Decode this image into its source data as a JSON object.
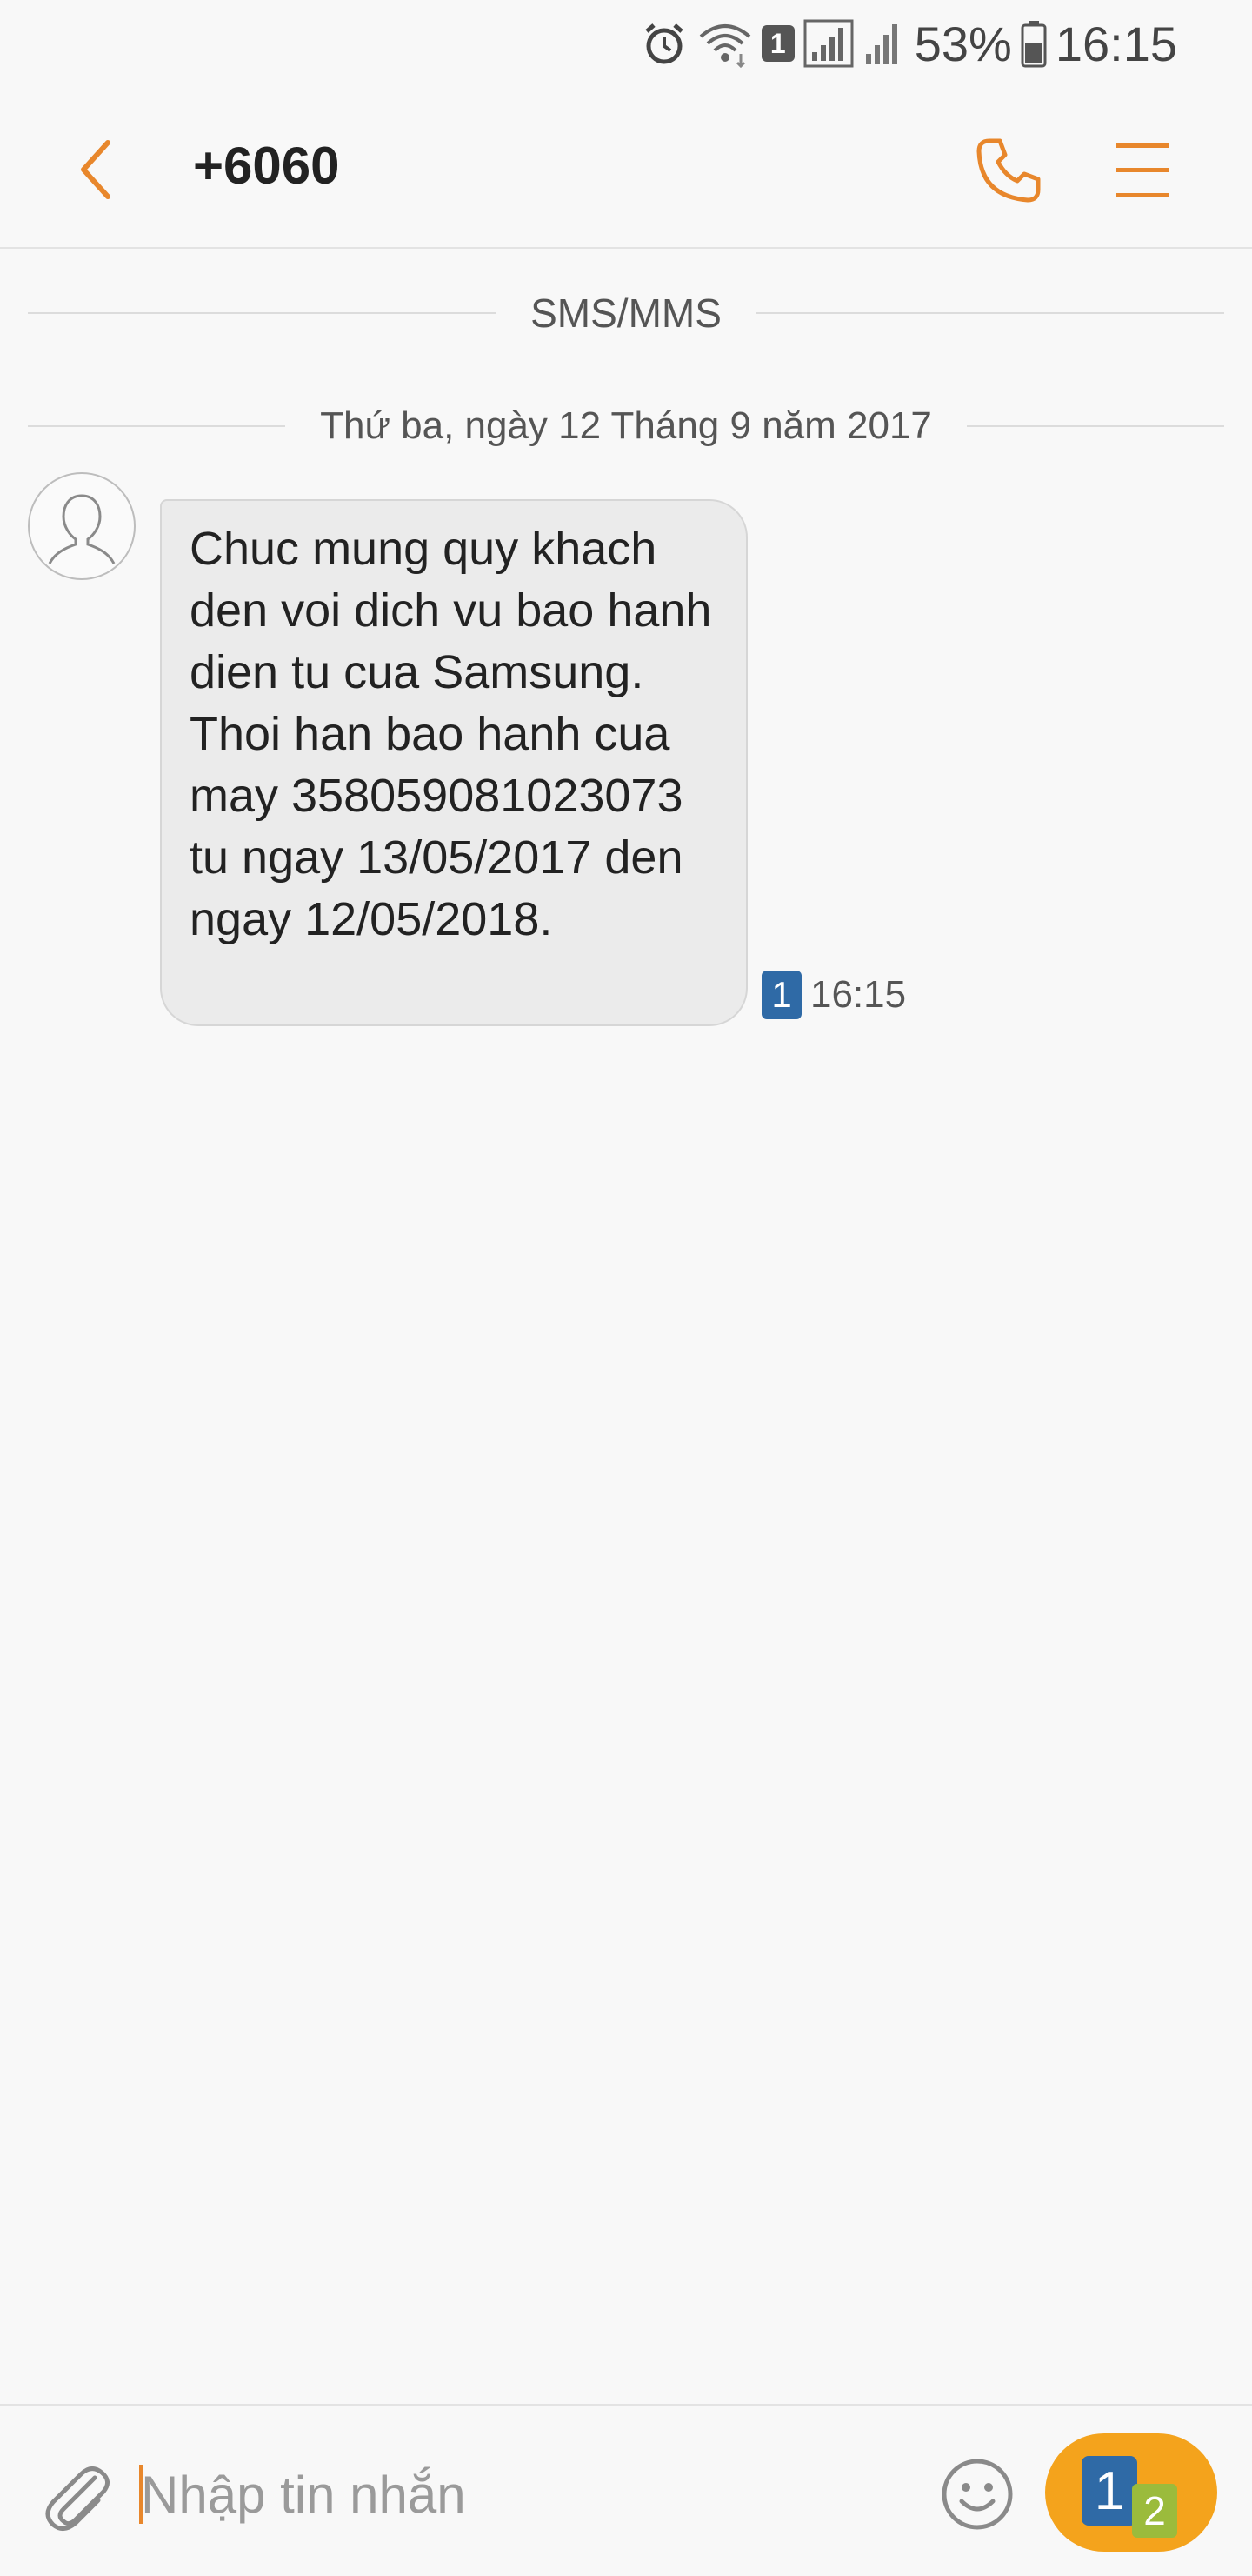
{
  "status_bar": {
    "sim_number": "1",
    "battery_percent": "53%",
    "battery_level": 0.53,
    "time": "16:15",
    "icons": [
      "alarm-icon",
      "wifi-icon",
      "sim-icon",
      "signal-icon",
      "signal-icon",
      "battery-icon"
    ]
  },
  "header": {
    "title": "+6060",
    "back_icon": "chevron-left-icon",
    "call_icon": "phone-icon",
    "menu_icon": "menu-icon"
  },
  "conversation": {
    "channel_label": "SMS/MMS",
    "date_label": "Thứ ba, ngày 12 Tháng 9 năm 2017",
    "messages": [
      {
        "text": "Chuc mung quy khach den voi dich vu bao hanh dien tu cua Samsung. Thoi han bao hanh cua may 358059081023073 tu ngay 13/05/2017 den ngay 12/05/2018.",
        "sim": "1",
        "time": "16:15"
      }
    ]
  },
  "composer": {
    "placeholder": "Nhập tin nhắn",
    "value": "",
    "attach_icon": "paperclip-icon",
    "emoji_icon": "smiley-icon",
    "send_sim_primary": "1",
    "send_sim_secondary": "2"
  },
  "colors": {
    "accent": "#e8872c",
    "send_button": "#f4a31c",
    "sim1": "#2f6aa6",
    "sim2": "#9bbb3c",
    "bubble_bg": "#ebebeb",
    "background": "#f8f8f8"
  }
}
